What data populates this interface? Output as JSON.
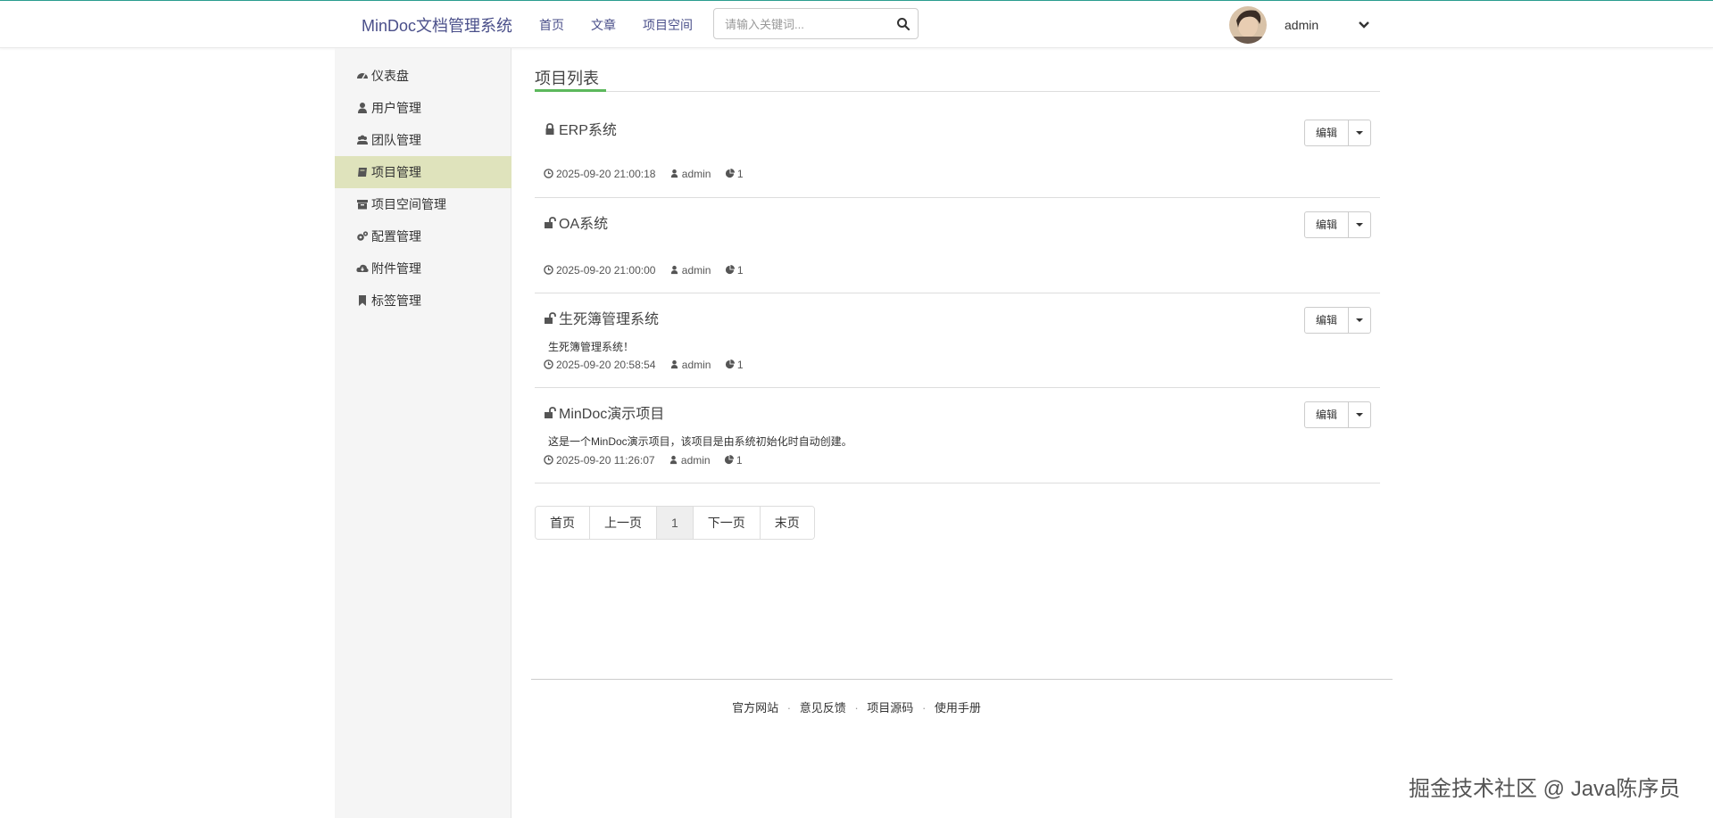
{
  "header": {
    "brand": "MinDoc文档管理系统",
    "nav": [
      "首页",
      "文章",
      "项目空间"
    ],
    "search_placeholder": "请输入关键词...",
    "user_name": "admin"
  },
  "sidebar": {
    "items": [
      {
        "label": "仪表盘",
        "icon": "dashboard-icon"
      },
      {
        "label": "用户管理",
        "icon": "user-icon"
      },
      {
        "label": "团队管理",
        "icon": "users-icon"
      },
      {
        "label": "项目管理",
        "icon": "book-icon",
        "active": true
      },
      {
        "label": "项目空间管理",
        "icon": "archive-icon"
      },
      {
        "label": "配置管理",
        "icon": "gears-icon"
      },
      {
        "label": "附件管理",
        "icon": "cloud-download-icon"
      },
      {
        "label": "标签管理",
        "icon": "bookmark-icon"
      }
    ]
  },
  "main": {
    "title": "项目列表",
    "edit_label": "编辑",
    "projects": [
      {
        "name": "ERP系统",
        "locked": true,
        "desc": "",
        "time": "2025-09-20 21:00:18",
        "author": "admin",
        "count": "1"
      },
      {
        "name": "OA系统",
        "locked": false,
        "desc": "",
        "time": "2025-09-20 21:00:00",
        "author": "admin",
        "count": "1"
      },
      {
        "name": "生死簿管理系统",
        "locked": false,
        "desc": "生死簿管理系统！",
        "time": "2025-09-20 20:58:54",
        "author": "admin",
        "count": "1"
      },
      {
        "name": "MinDoc演示项目",
        "locked": false,
        "desc": "这是一个MinDoc演示项目，该项目是由系统初始化时自动创建。",
        "time": "2025-09-20 11:26:07",
        "author": "admin",
        "count": "1"
      }
    ],
    "pager": [
      "首页",
      "上一页",
      "1",
      "下一页",
      "末页"
    ]
  },
  "footer": {
    "links": [
      "官方网站",
      "意见反馈",
      "项目源码",
      "使用手册"
    ],
    "separator": "·"
  },
  "watermark": "掘金技术社区 @ Java陈序员"
}
